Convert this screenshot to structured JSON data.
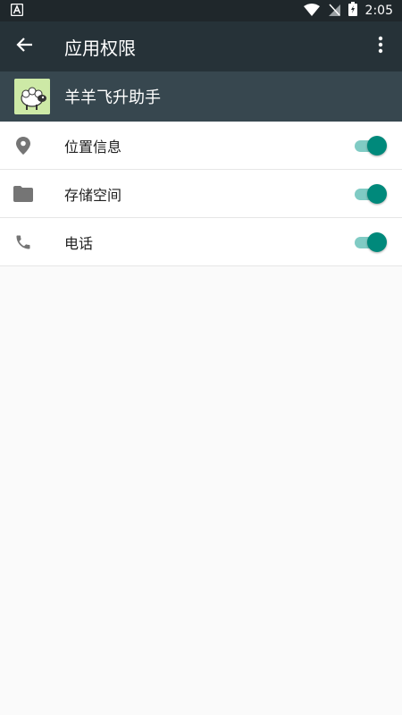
{
  "status_bar": {
    "time": "2:05",
    "icons": [
      "notification-a-icon",
      "wifi-icon",
      "no-sim-icon",
      "battery-charging-icon"
    ]
  },
  "toolbar": {
    "title": "应用权限",
    "back_icon": "arrow-back-icon",
    "overflow_icon": "more-vert-icon"
  },
  "app": {
    "name": "羊羊飞升助手",
    "icon": "sheep-app-icon"
  },
  "permissions": [
    {
      "label": "位置信息",
      "icon": "location-pin-icon",
      "enabled": true
    },
    {
      "label": "存储空间",
      "icon": "folder-icon",
      "enabled": true
    },
    {
      "label": "电话",
      "icon": "phone-icon",
      "enabled": true
    }
  ],
  "colors": {
    "status_bar": "#1f272b",
    "toolbar": "#263238",
    "app_header": "#37474f",
    "toggle_thumb": "#00897b",
    "toggle_track": "#80cbc4",
    "background": "#fafafa"
  }
}
